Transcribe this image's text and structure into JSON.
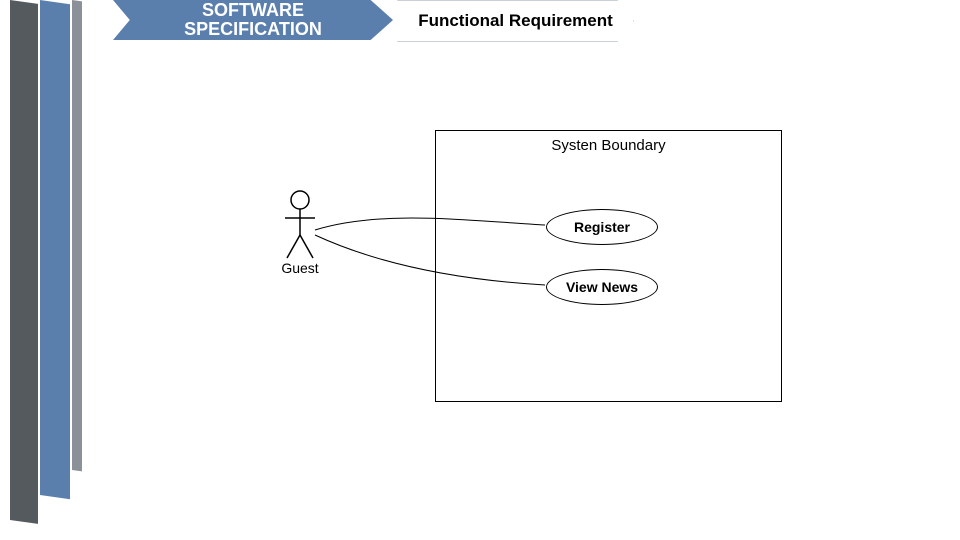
{
  "breadcrumb": {
    "item1": "SOFTWARE\nSPECIFICATION",
    "item2": "Functional Requirement"
  },
  "diagram": {
    "actor_label": "Guest",
    "system_boundary_label": "Systen Boundary",
    "usecase1": "Register",
    "usecase2": "View News"
  }
}
